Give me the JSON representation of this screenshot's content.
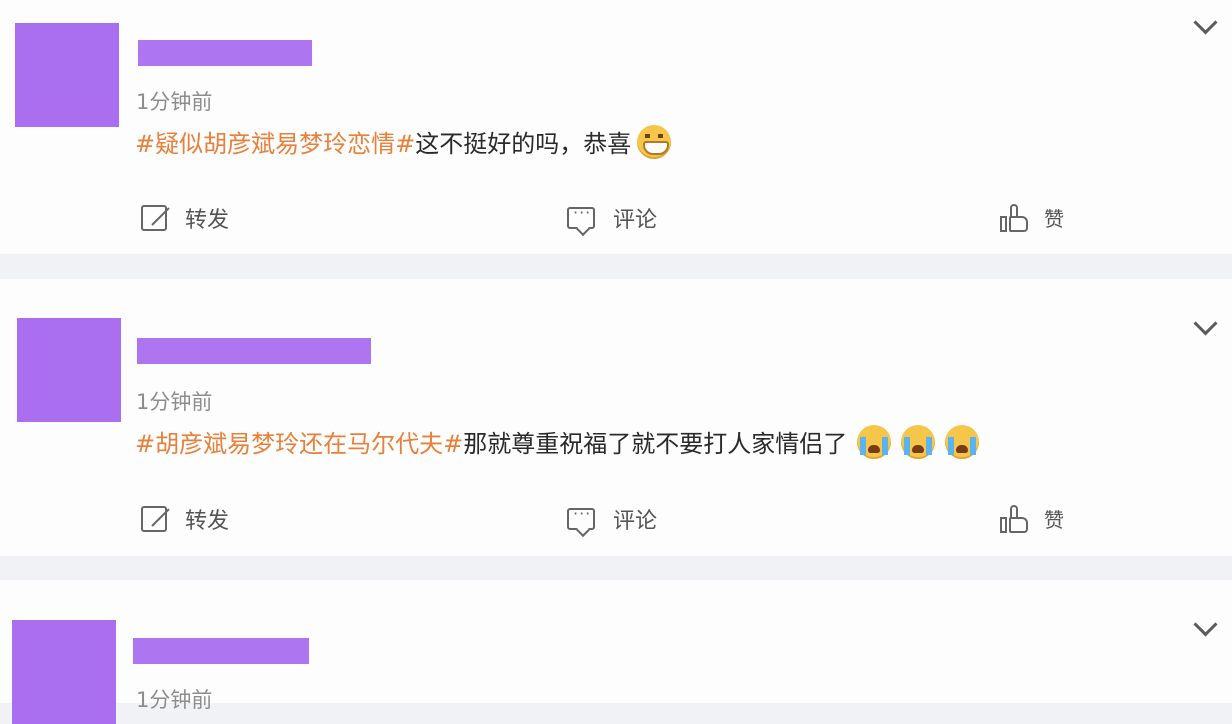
{
  "posts": [
    {
      "time": "1分钟前",
      "topic": "#疑似胡彦斌易梦玲恋情#",
      "text": "这不挺好的吗，恭喜",
      "emojis": [
        "grin-emoji"
      ],
      "actions": {
        "repost": "转发",
        "comment": "评论",
        "like": "赞"
      }
    },
    {
      "time": "1分钟前",
      "topic": "#胡彦斌易梦玲还在马尔代夫#",
      "text": "那就尊重祝福了就不要打人家情侣了",
      "emojis": [
        "crying-emoji",
        "crying-emoji",
        "crying-emoji"
      ],
      "actions": {
        "repost": "转发",
        "comment": "评论",
        "like": "赞"
      }
    },
    {
      "time": "1分钟前"
    }
  ],
  "colors": {
    "topic": "#e8803a",
    "mask": "#ad75f0",
    "background": "#f1f2f5"
  },
  "icons": [
    "chevron-down-icon",
    "repost-icon",
    "comment-icon",
    "like-icon"
  ]
}
